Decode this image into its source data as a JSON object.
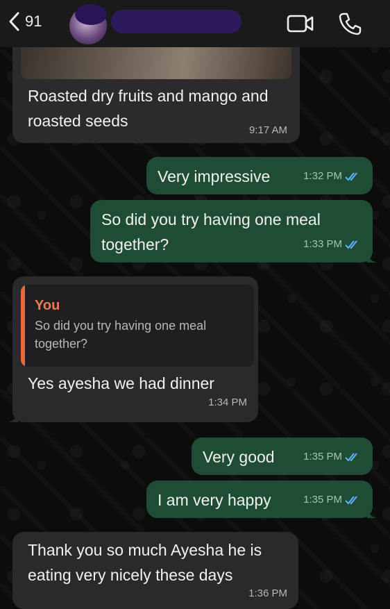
{
  "header": {
    "back_count": "91"
  },
  "messages": [
    {
      "id": "m1",
      "direction": "incoming",
      "text": "Roasted dry fruits and mango and roasted seeds",
      "time": "9:17 AM"
    },
    {
      "id": "m2",
      "direction": "outgoing",
      "text": "Very impressive",
      "time": "1:32 PM",
      "status": "read"
    },
    {
      "id": "m3",
      "direction": "outgoing",
      "text": "So did you try having one meal together?",
      "time": "1:33 PM",
      "status": "read"
    },
    {
      "id": "m4",
      "direction": "incoming",
      "quote_author": "You",
      "quote_text": "So did you try having one meal together?",
      "text": "Yes ayesha we had dinner",
      "time": "1:34 PM"
    },
    {
      "id": "m5",
      "direction": "outgoing",
      "text": "Very good",
      "time": "1:35 PM",
      "status": "read"
    },
    {
      "id": "m6",
      "direction": "outgoing",
      "text": "I am very happy",
      "time": "1:35 PM",
      "status": "read"
    },
    {
      "id": "m7",
      "direction": "incoming",
      "text": "Thank you so much Ayesha he is eating very nicely these days",
      "time": "1:36 PM"
    }
  ],
  "colors": {
    "incoming_bubble": "#2a2a2c",
    "outgoing_bubble": "#1f4d33",
    "read_ticks": "#5fb4ff",
    "quote_accent": "#e8693a"
  },
  "icons": [
    "back-chevron-icon",
    "video-call-icon",
    "phone-call-icon",
    "double-check-icon"
  ]
}
